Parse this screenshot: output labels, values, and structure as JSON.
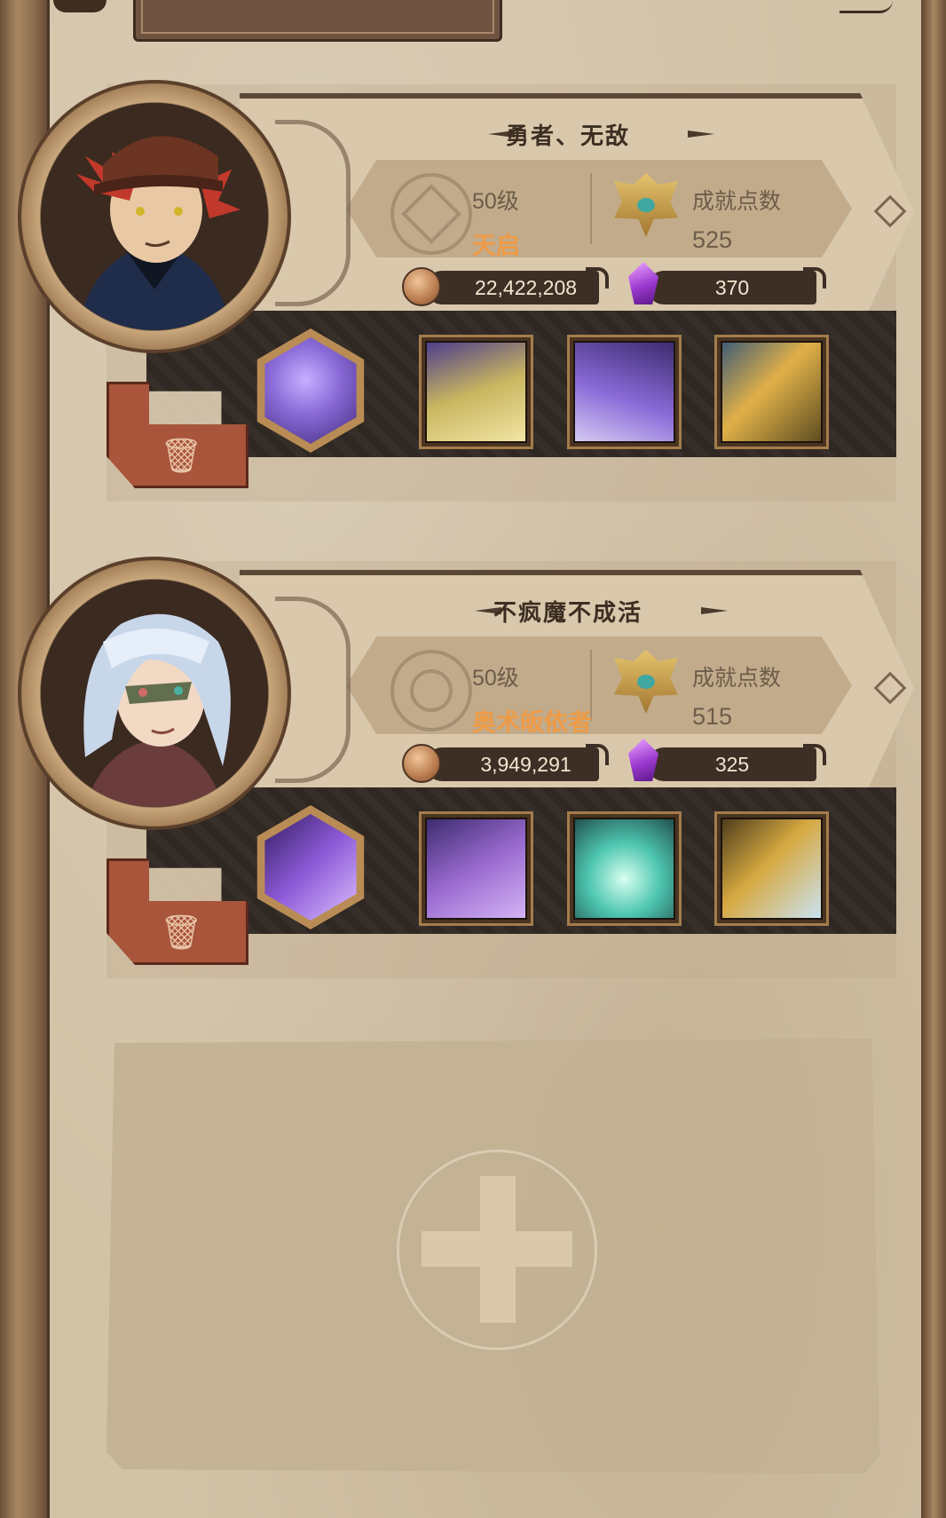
{
  "characters": [
    {
      "name": "勇者、无敌",
      "level": "50级",
      "class": "天启",
      "achievement_label": "成就点数",
      "achievement_points": "525",
      "gold": "22,422,208",
      "gems": "370",
      "portrait": "red-haired-man-portrait",
      "skills": [
        {
          "icon": "purple-shadow-skill-icon",
          "colors": [
            "#3a2470",
            "#8a6ad8",
            "#c7b0ff"
          ]
        },
        {
          "icon": "golden-knight-skill-icon",
          "colors": [
            "#4a3a8c",
            "#c9b660",
            "#f3e6a6"
          ]
        },
        {
          "icon": "purple-clone-skill-icon",
          "colors": [
            "#3a2a6c",
            "#8a6ad8",
            "#d7cdf2"
          ]
        },
        {
          "icon": "golden-burst-skill-icon",
          "colors": [
            "#5a4a20",
            "#e0b048",
            "#3c5a78"
          ]
        }
      ]
    },
    {
      "name": "不疯魔不成活",
      "level": "50级",
      "class": "奥术皈依者",
      "achievement_label": "成就点数",
      "achievement_points": "515",
      "gold": "3,949,291",
      "gems": "325",
      "portrait": "silver-haired-woman-portrait",
      "skills": [
        {
          "icon": "violet-shard-skill-icon",
          "colors": [
            "#2c1a5a",
            "#8d5ad8",
            "#e0c6ff"
          ]
        },
        {
          "icon": "arcane-slash-skill-icon",
          "colors": [
            "#3a2a6c",
            "#9a6ad0",
            "#d6b6f6"
          ]
        },
        {
          "icon": "frost-crystal-skill-icon",
          "colors": [
            "#1f4a4a",
            "#4ec6b0",
            "#d8fff0"
          ]
        },
        {
          "icon": "golden-shield-skill-icon",
          "colors": [
            "#4a3a1c",
            "#d6a840",
            "#c9e4f6"
          ]
        }
      ]
    }
  ],
  "colors": {
    "paper": "#d2c2a6",
    "frame": "#6b4f36",
    "class_text": "#ee9b46",
    "dark_strip": "#2f2722",
    "trash_flag": "#a9553b"
  },
  "add_slot": {
    "icon": "plus-icon"
  }
}
